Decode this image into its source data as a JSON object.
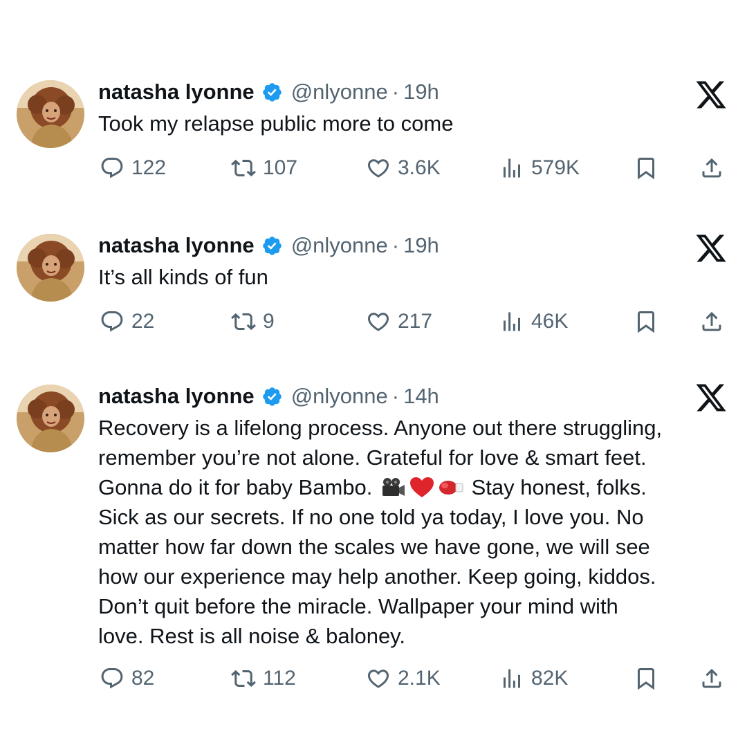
{
  "tweets": [
    {
      "name": "natasha lyonne",
      "handle": "@nlyonne",
      "separator": "·",
      "time": "19h",
      "text": "Took my relapse public more to come",
      "replies": "122",
      "retweets": "107",
      "likes": "3.6K",
      "views": "579K"
    },
    {
      "name": "natasha lyonne",
      "handle": "@nlyonne",
      "separator": "·",
      "time": "19h",
      "text": "It’s all kinds of fun",
      "replies": "22",
      "retweets": "9",
      "likes": "217",
      "views": "46K"
    },
    {
      "name": "natasha lyonne",
      "handle": "@nlyonne",
      "separator": "·",
      "time": "14h",
      "text_lines": [
        "Recovery is a lifelong process. Anyone out there struggling,",
        "remember you’re not alone. Grateful for love & smart feet.",
        "Gonna do it for baby Bambo.",
        "Stay honest, folks.",
        "Sick as our secrets. If no one told ya today, I love you. No",
        "matter how far down the scales we have gone, we will see",
        "how our experience may help another. Keep going, kiddos.",
        "Don’t quit before the miracle. Wallpaper your mind with",
        "love. Rest is all noise & baloney."
      ],
      "emojis": [
        "movie-camera-emoji",
        "red-heart-emoji",
        "boxing-glove-emoji"
      ],
      "replies": "82",
      "retweets": "112",
      "likes": "2.1K",
      "views": "82K"
    }
  ],
  "icons": {
    "reply": "reply-icon",
    "retweet": "retweet-icon",
    "like": "heart-icon",
    "views": "views-icon",
    "bookmark": "bookmark-icon",
    "share": "share-icon",
    "brand": "x-logo-icon",
    "verified": "verified-badge-icon"
  },
  "colors": {
    "verified": "#1d9bf0",
    "text": "#0f1419",
    "muted": "#536471"
  }
}
